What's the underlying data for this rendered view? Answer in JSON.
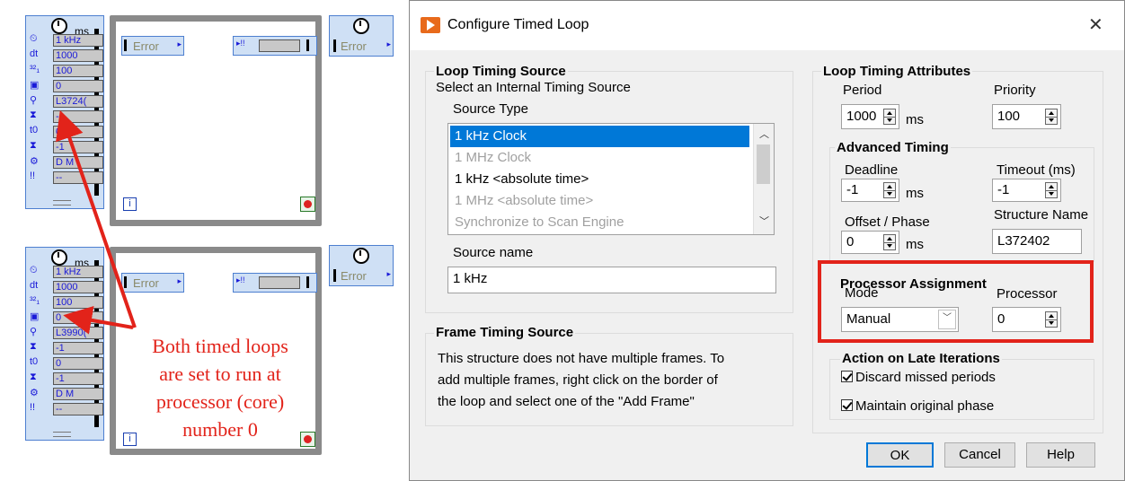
{
  "diagram": {
    "loop1": {
      "header_unit": "ms",
      "rows": [
        {
          "tag": "⏲",
          "value": "1 kHz"
        },
        {
          "tag": "dt",
          "value": "1000"
        },
        {
          "tag": "³²₁",
          "value": "100"
        },
        {
          "tag": "▣",
          "value": "0"
        },
        {
          "tag": "⚲",
          "value": "L3724("
        },
        {
          "tag": "⧗",
          "value": "-1"
        },
        {
          "tag": "t0",
          "value": "0"
        },
        {
          "tag": "⧗",
          "value": "-1"
        },
        {
          "tag": "⚙",
          "value": "D M"
        },
        {
          "tag": "!!",
          "value": "--"
        }
      ],
      "error_in": "Error",
      "error_out": "Error",
      "iteration_symbol": "i"
    },
    "loop2": {
      "header_unit": "ms",
      "rows": [
        {
          "tag": "⏲",
          "value": "1 kHz"
        },
        {
          "tag": "dt",
          "value": "1000"
        },
        {
          "tag": "³²₁",
          "value": "100"
        },
        {
          "tag": "▣",
          "value": "0"
        },
        {
          "tag": "⚲",
          "value": "L3990("
        },
        {
          "tag": "⧗",
          "value": "-1"
        },
        {
          "tag": "t0",
          "value": "0"
        },
        {
          "tag": "⧗",
          "value": "-1"
        },
        {
          "tag": "⚙",
          "value": "D M"
        },
        {
          "tag": "!!",
          "value": "--"
        }
      ],
      "error_in": "Error",
      "error_out": "Error",
      "iteration_symbol": "i"
    },
    "annotation_lines": [
      "Both timed loops",
      "are set to run at",
      "processor (core)",
      "number 0"
    ],
    "annotation_color": "#e2231a"
  },
  "dialog": {
    "title": "Configure Timed Loop",
    "close_glyph": "✕",
    "loop_timing_source": {
      "title": "Loop Timing Source",
      "subtitle": "Select an Internal Timing Source",
      "source_type_label": "Source Type",
      "source_types": [
        {
          "label": "1 kHz Clock",
          "state": "selected"
        },
        {
          "label": "1 MHz Clock",
          "state": "disabled"
        },
        {
          "label": "1 kHz <absolute time>",
          "state": "enabled"
        },
        {
          "label": "1 MHz <absolute time>",
          "state": "disabled"
        },
        {
          "label": "Synchronize to Scan Engine",
          "state": "disabled"
        }
      ],
      "source_name_label": "Source name",
      "source_name_value": "1 kHz"
    },
    "frame_timing_source": {
      "title": "Frame Timing Source",
      "lines": [
        "This structure does not have multiple frames. To",
        "add multiple frames, right click on the border of",
        "the loop and select one of the \"Add Frame\""
      ]
    },
    "loop_timing_attributes": {
      "title": "Loop Timing Attributes",
      "period_label": "Period",
      "period_value": "1000",
      "period_unit": "ms",
      "priority_label": "Priority",
      "priority_value": "100"
    },
    "advanced_timing": {
      "title": "Advanced Timing",
      "deadline_label": "Deadline",
      "deadline_value": "-1",
      "deadline_unit": "ms",
      "timeout_label": "Timeout (ms)",
      "timeout_value": "-1",
      "offset_label": "Offset / Phase",
      "offset_value": "0",
      "offset_unit": "ms",
      "structure_name_label": "Structure Name",
      "structure_name_value": "L372402"
    },
    "processor_assignment": {
      "title": "Processor Assignment",
      "mode_label": "Mode",
      "mode_value": "Manual",
      "processor_label": "Processor",
      "processor_value": "0",
      "highlight_color": "#e2231a"
    },
    "late_iterations": {
      "title": "Action on Late Iterations",
      "discard_label": "Discard missed periods",
      "discard_checked": true,
      "maintain_label": "Maintain original phase",
      "maintain_checked": true
    },
    "buttons": {
      "ok": "OK",
      "cancel": "Cancel",
      "help": "Help"
    },
    "colors": {
      "selection": "#0078d7",
      "title_icon": "#e86a1b",
      "disabled_text": "#a0a0a0"
    }
  }
}
